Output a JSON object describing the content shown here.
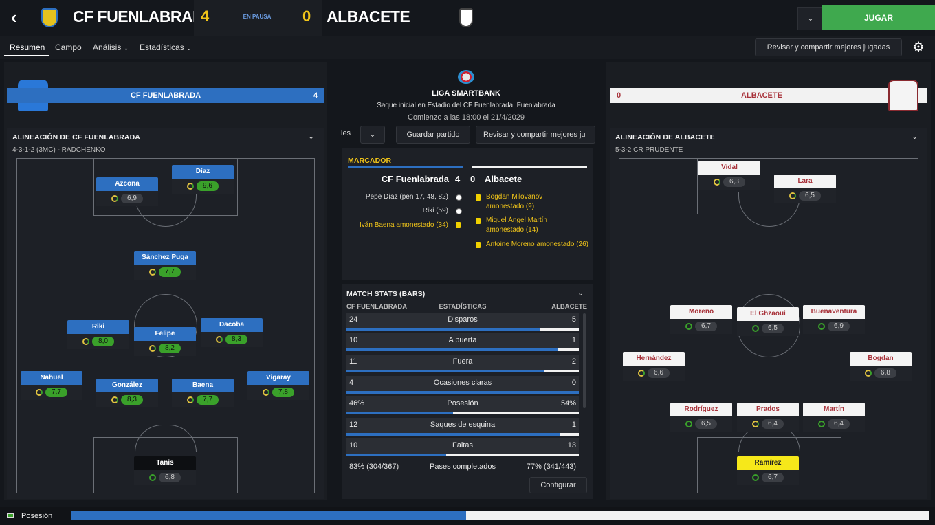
{
  "header": {
    "home_team": "CF FUENLABRADA",
    "home_score": "4",
    "status": "EN PAUSA",
    "away_score": "0",
    "away_team": "ALBACETE",
    "play_button": "JUGAR"
  },
  "nav": {
    "tabs": [
      "Resumen",
      "Campo",
      "Análisis",
      "Estadísticas"
    ],
    "review_button": "Revisar y compartir mejores jugadas"
  },
  "home_bar": {
    "team": "CF FUENLABRADA",
    "score": "4"
  },
  "away_bar": {
    "score": "0",
    "team": "ALBACETE"
  },
  "match_info": {
    "league": "LIGA SMARTBANK",
    "venue": "Saque inicial en Estadio del CF Fuenlabrada, Fuenlabrada",
    "kickoff": "Comienzo a las 18:00 el 21/4/2029"
  },
  "center_toolbar": {
    "cut_label": "les",
    "save_button": "Guardar partido",
    "review_button": "Revisar y compartir mejores ju"
  },
  "scoreboard": {
    "title": "MARCADOR",
    "home_team": "CF Fuenlabrada",
    "home_score": "4",
    "away_score": "0",
    "away_team": "Albacete",
    "home_events": [
      "Pepe Díaz (pen 17, 48, 82)",
      "Riki (59)",
      "Iván Baena amonestado (34)"
    ],
    "away_events": [
      "Bogdan Milovanov amonestado (9)",
      "Miguel Ángel Martín amonestado (14)",
      "Antoine Moreno amonestado (26)"
    ]
  },
  "match_stats": {
    "title": "MATCH STATS (BARS)",
    "col_home": "CF FUENLABRADA",
    "col_mid": "ESTADÍSTICAS",
    "col_away": "ALBACETE",
    "rows": [
      {
        "home": "24",
        "label": "Disparos",
        "away": "5",
        "home_frac": 0.83
      },
      {
        "home": "10",
        "label": "A puerta",
        "away": "1",
        "home_frac": 0.91
      },
      {
        "home": "11",
        "label": "Fuera",
        "away": "2",
        "home_frac": 0.85
      },
      {
        "home": "4",
        "label": "Ocasiones claras",
        "away": "0",
        "home_frac": 1.0
      },
      {
        "home": "46%",
        "label": "Posesión",
        "away": "54%",
        "home_frac": 0.46
      },
      {
        "home": "12",
        "label": "Saques de esquina",
        "away": "1",
        "home_frac": 0.92
      },
      {
        "home": "10",
        "label": "Faltas",
        "away": "13",
        "home_frac": 0.43
      }
    ],
    "passes": {
      "home": "83% (304/367)",
      "label": "Pases completados",
      "away": "77% (341/443)"
    },
    "configure_button": "Configurar"
  },
  "home_lineup": {
    "title": "ALINEACIÓN DE CF FUENLABRADA",
    "formation": "4-3-1-2 (3MC) - RADCHENKO",
    "players": [
      {
        "name": "Díaz",
        "rating": "9,6",
        "good": true
      },
      {
        "name": "Azcona",
        "rating": "6,9",
        "good": false
      },
      {
        "name": "Sánchez Puga",
        "rating": "7,7",
        "good": true
      },
      {
        "name": "Riki",
        "rating": "8,0",
        "good": true
      },
      {
        "name": "Felipe",
        "rating": "8,2",
        "good": true
      },
      {
        "name": "Dacoba",
        "rating": "8,3",
        "good": true
      },
      {
        "name": "Nahuel",
        "rating": "7,7",
        "good": true
      },
      {
        "name": "González",
        "rating": "8,3",
        "good": true
      },
      {
        "name": "Baena",
        "rating": "7,7",
        "good": true
      },
      {
        "name": "Vigaray",
        "rating": "7,8",
        "good": true
      },
      {
        "name": "Tanis",
        "rating": "6,8",
        "good": false
      }
    ]
  },
  "away_lineup": {
    "title": "ALINEACIÓN DE ALBACETE",
    "formation": "5-3-2 CR PRUDENTE",
    "players": [
      {
        "name": "Vidal",
        "rating": "6,3"
      },
      {
        "name": "Lara",
        "rating": "6,5"
      },
      {
        "name": "Moreno",
        "rating": "6,7"
      },
      {
        "name": "El Ghzaoui",
        "rating": "6,5"
      },
      {
        "name": "Buenaventura",
        "rating": "6,9"
      },
      {
        "name": "Hernández",
        "rating": "6,6"
      },
      {
        "name": "Bogdan",
        "rating": "6,8"
      },
      {
        "name": "Rodríguez",
        "rating": "6,5"
      },
      {
        "name": "Prados",
        "rating": "6,4"
      },
      {
        "name": "Martín",
        "rating": "6,4"
      },
      {
        "name": "Ramírez",
        "rating": "6,7"
      }
    ]
  },
  "footer": {
    "possession_label": "Posesión",
    "home_possession": 0.46
  },
  "colors": {
    "home": "#2d6fc0",
    "away_text": "#a8323a",
    "accent_green": "#3aa12a",
    "gold": "#f0c419",
    "keeper_yellow": "#f6e81a"
  }
}
